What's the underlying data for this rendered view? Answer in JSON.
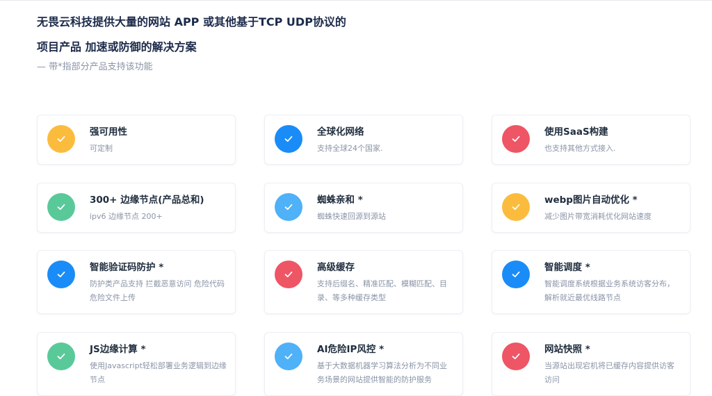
{
  "header": {
    "title_line1": "无畏云科技提供大量的网站 APP 或其他基于TCP UDP协议的",
    "title_line2": "项目产品 加速或防御的解决方案",
    "subtitle": "— 带*指部分产品支持该功能"
  },
  "colors": {
    "orange": "#fbbc3e",
    "blue": "#1a8cf7",
    "red": "#ee5565",
    "green": "#5ac99a",
    "lightblue": "#4fb1f7"
  },
  "features": [
    {
      "title": "强可用性",
      "desc": "可定制",
      "color": "orange",
      "icon": "check-icon"
    },
    {
      "title": "全球化网络",
      "desc": "支持全球24个国家.",
      "color": "blue",
      "icon": "check-icon"
    },
    {
      "title": "使用SaaS构建",
      "desc": "也支持其他方式接入.",
      "color": "red",
      "icon": "check-icon"
    },
    {
      "title": "300+ 边缘节点(产品总和)",
      "desc": "ipv6 边缘节点 200+",
      "color": "green",
      "icon": "check-icon"
    },
    {
      "title": "蜘蛛亲和 *",
      "desc": "蜘蛛快速回源到源站",
      "color": "lightblue",
      "icon": "check-icon"
    },
    {
      "title": "webp图片自动优化 *",
      "desc": "减少图片带宽消耗优化网站速度",
      "color": "orange",
      "icon": "check-icon"
    },
    {
      "title": "智能验证码防护 *",
      "desc": "防护类产品支持 拦截恶意访问 危险代码 危险文件上传",
      "color": "blue",
      "icon": "check-icon"
    },
    {
      "title": "高级缓存",
      "desc": "支持后缀名、精准匹配、模糊匹配、目录、等多种缓存类型",
      "color": "red",
      "icon": "check-icon"
    },
    {
      "title": "智能调度 *",
      "desc": "智能调度系统根据业务系统访客分布，解析就近最优线路节点",
      "color": "blue",
      "icon": "check-icon"
    },
    {
      "title": "JS边缘计算 *",
      "desc": "使用Javascript轻松部署业务逻辑到边缘节点",
      "color": "green",
      "icon": "check-icon"
    },
    {
      "title": "AI危险IP风控 *",
      "desc": "基于大数据机器学习算法分析为不同业务场景的网站提供智能的防护服务",
      "color": "lightblue",
      "icon": "check-icon"
    },
    {
      "title": "网站快照 *",
      "desc": "当源站出现宕机将已缓存内容提供访客访问",
      "color": "red",
      "icon": "check-icon"
    }
  ]
}
